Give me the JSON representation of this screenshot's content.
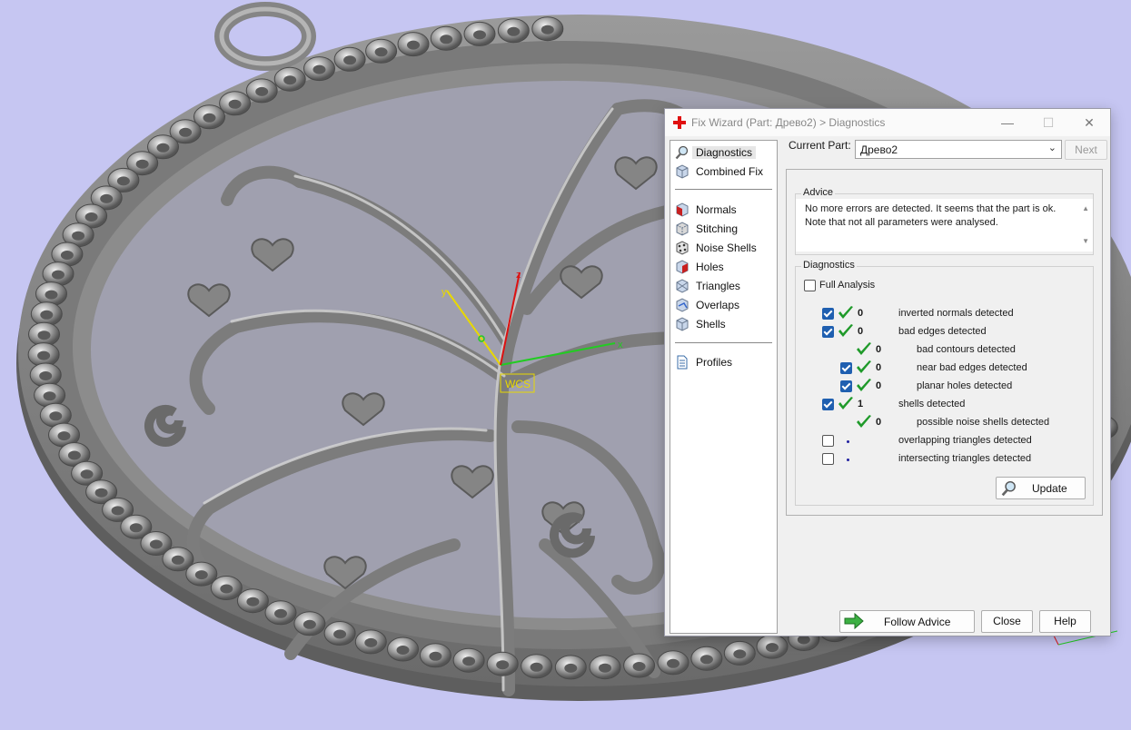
{
  "viewport": {
    "axes_label": "WCS",
    "axis_x_label": "x",
    "axis_y_label": "y",
    "axis_z_label": "z",
    "colors": {
      "background": "#c6c6f2",
      "model": "#8a8a8a",
      "axis_x": "#22cc22",
      "axis_y": "#e8d800",
      "axis_z": "#dd1111"
    }
  },
  "dialog": {
    "title": "Fix Wizard (Part: Древо2) > Diagnostics",
    "title_icon": "red-cross-icon",
    "window_buttons": {
      "minimize": "—",
      "maximize": "☐",
      "close": "✕"
    },
    "nav": {
      "group1": [
        {
          "label": "Diagnostics",
          "icon": "magnifier-icon",
          "selected": true
        },
        {
          "label": "Combined Fix",
          "icon": "cube-icon"
        }
      ],
      "group2": [
        {
          "label": "Normals",
          "icon": "normals-cube-icon"
        },
        {
          "label": "Stitching",
          "icon": "stitching-cube-icon"
        },
        {
          "label": "Noise Shells",
          "icon": "noise-shells-icon"
        },
        {
          "label": "Holes",
          "icon": "holes-cube-icon"
        },
        {
          "label": "Triangles",
          "icon": "triangles-cube-icon"
        },
        {
          "label": "Overlaps",
          "icon": "overlaps-cube-icon"
        },
        {
          "label": "Shells",
          "icon": "shells-cube-icon"
        }
      ],
      "group3": [
        {
          "label": "Profiles",
          "icon": "document-icon"
        }
      ]
    },
    "current_part_label": "Current Part:",
    "current_part_value": "Древо2",
    "next_label": "Next",
    "advice": {
      "title": "Advice",
      "text": "No more errors are detected. It seems that the part is ok. Note that not all parameters were analysed."
    },
    "diagnostics": {
      "title": "Diagnostics",
      "full_analysis_label": "Full Analysis",
      "full_analysis_checked": false,
      "rows": [
        {
          "checked": true,
          "status": "ok",
          "count": "0",
          "label": "inverted normals detected",
          "indent": 0
        },
        {
          "checked": true,
          "status": "ok",
          "count": "0",
          "label": "bad edges detected",
          "indent": 0
        },
        {
          "checked": null,
          "status": "ok",
          "count": "0",
          "label": "bad contours detected",
          "indent": 1
        },
        {
          "checked": true,
          "status": "ok",
          "count": "0",
          "label": "near bad edges detected",
          "indent": 1
        },
        {
          "checked": true,
          "status": "ok",
          "count": "0",
          "label": "planar holes detected",
          "indent": 1
        },
        {
          "checked": true,
          "status": "ok",
          "count": "1",
          "label": "shells detected",
          "indent": 0
        },
        {
          "checked": null,
          "status": "ok",
          "count": "0",
          "label": "possible noise shells detected",
          "indent": 1
        },
        {
          "checked": false,
          "status": "none",
          "count": "",
          "label": "overlapping triangles detected",
          "indent": 0
        },
        {
          "checked": false,
          "status": "none",
          "count": "",
          "label": "intersecting triangles detected",
          "indent": 0
        }
      ],
      "update_label": "Update"
    },
    "buttons": {
      "follow_advice": "Follow Advice",
      "close": "Close",
      "help": "Help"
    }
  }
}
